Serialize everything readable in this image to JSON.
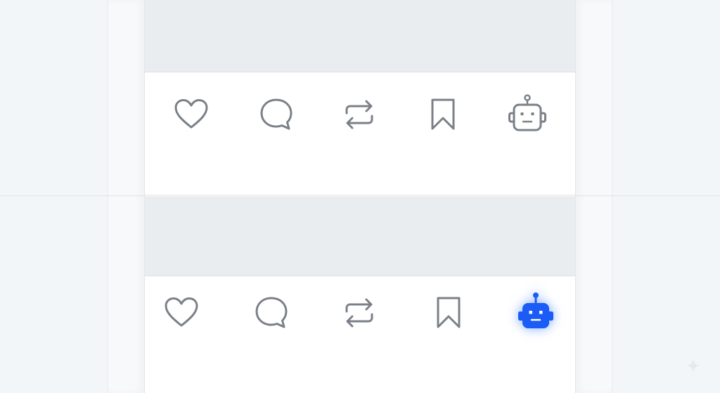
{
  "colors": {
    "icon_default": "#7b8088",
    "icon_active": "#1a5cf5",
    "media_placeholder": "#e9edf0",
    "background": "#f4f7fa"
  },
  "posts": [
    {
      "actions": [
        {
          "icon": "heart-icon",
          "state": "default"
        },
        {
          "icon": "comment-icon",
          "state": "default"
        },
        {
          "icon": "repost-icon",
          "state": "default"
        },
        {
          "icon": "bookmark-icon",
          "state": "default"
        },
        {
          "icon": "robot-icon",
          "state": "default"
        }
      ]
    },
    {
      "actions": [
        {
          "icon": "heart-icon",
          "state": "default"
        },
        {
          "icon": "comment-icon",
          "state": "default"
        },
        {
          "icon": "repost-icon",
          "state": "default"
        },
        {
          "icon": "bookmark-icon",
          "state": "default"
        },
        {
          "icon": "robot-icon",
          "state": "active"
        }
      ]
    }
  ],
  "watermark": {
    "icon": "sparkle-icon"
  }
}
